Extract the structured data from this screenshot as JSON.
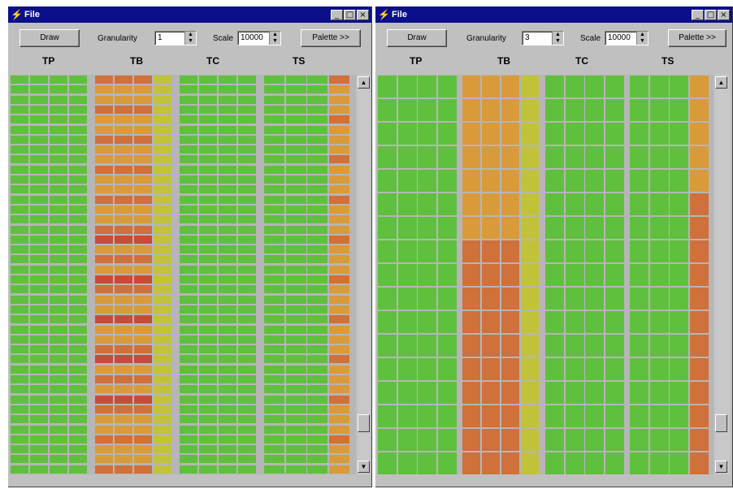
{
  "windows": [
    {
      "id": "left",
      "title": "File",
      "draw_label": "Draw",
      "granularity_label": "Granularity",
      "granularity_value": "1",
      "scale_label": "Scale",
      "scale_value": "10000",
      "palette_label": "Palette >>",
      "columns": [
        "TP",
        "TB",
        "TC",
        "TS"
      ]
    },
    {
      "id": "right",
      "title": "File",
      "draw_label": "Draw",
      "granularity_label": "Granularity",
      "granularity_value": "3",
      "scale_label": "Scale",
      "scale_value": "10000",
      "palette_label": "Palette >>",
      "columns": [
        "TP",
        "TB",
        "TC",
        "TS"
      ]
    }
  ],
  "colors": {
    "titlebar": "#0b0f8a",
    "green": "#5fc03d",
    "yellow_green": "#c2c23a",
    "orange": "#d99a3a",
    "dark_orange": "#d0703a",
    "red": "#c94a3a"
  },
  "icons": [
    "app-icon",
    "minimize-icon",
    "maximize-icon",
    "close-icon",
    "spin-up-down-icon",
    "scroll-up-icon",
    "scroll-down-icon"
  ]
}
